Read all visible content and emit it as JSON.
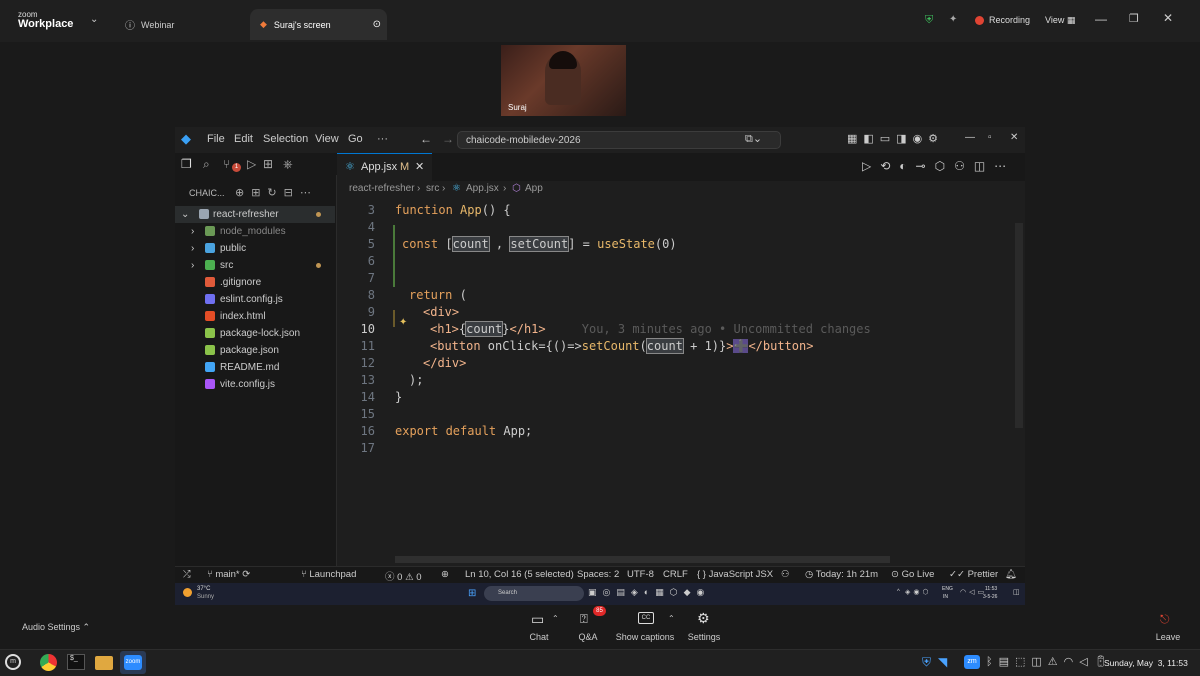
{
  "zoom": {
    "logo_small": "zoom",
    "logo_big": "Workplace",
    "tabs": [
      {
        "label": "Webinar"
      },
      {
        "label": "Suraj's screen"
      }
    ],
    "recording_label": "Recording",
    "view_label": "View",
    "participant_name": "Suraj",
    "audio_settings": "Audio Settings",
    "bottom": {
      "chat": "Chat",
      "qa": "Q&A",
      "qa_badge": "85",
      "captions": "Show captions",
      "settings": "Settings",
      "leave": "Leave"
    }
  },
  "vscode": {
    "menu": [
      "File",
      "Edit",
      "Selection",
      "View",
      "Go",
      "···"
    ],
    "command_center": "chaicode-mobiledev-2026",
    "explorer_title": "CHAIC...",
    "root_folder": "react-refresher",
    "files": [
      {
        "name": "node_modules",
        "kind": "folder",
        "color": "#6a9955"
      },
      {
        "name": "public",
        "kind": "folder",
        "color": "#4aa3df"
      },
      {
        "name": "src",
        "kind": "folder",
        "color": "#4caf50"
      },
      {
        "name": ".gitignore",
        "kind": "file",
        "color": "#e05a3a"
      },
      {
        "name": "eslint.config.js",
        "kind": "file",
        "color": "#6f6ff0"
      },
      {
        "name": "index.html",
        "kind": "file",
        "color": "#e44d26"
      },
      {
        "name": "package-lock.json",
        "kind": "file",
        "color": "#8bc34a"
      },
      {
        "name": "package.json",
        "kind": "file",
        "color": "#8bc34a"
      },
      {
        "name": "README.md",
        "kind": "file",
        "color": "#42a5f5"
      },
      {
        "name": "vite.config.js",
        "kind": "file",
        "color": "#a855f7"
      }
    ],
    "tab_label": "App.jsx",
    "tab_modified": "M",
    "breadcrumb": [
      "react-refresher",
      "src",
      "App.jsx",
      "App"
    ],
    "line_numbers": [
      "3",
      "4",
      "5",
      "6",
      "7",
      "8",
      "9",
      "10",
      "11",
      "12",
      "13",
      "14",
      "15",
      "16",
      "17"
    ],
    "blame": "You, 3 minutes ago • Uncommitted changes",
    "status": {
      "branch": "main*",
      "launchpad": "Launchpad",
      "errors": "0",
      "warnings": "0",
      "cursor": "Ln 10, Col 16 (5 selected)",
      "spaces": "Spaces: 2",
      "encoding": "UTF-8",
      "eol": "CRLF",
      "language": "JavaScript JSX",
      "today": "Today: 1h 21m",
      "golive": "Go Live",
      "prettier": "Prettier"
    }
  },
  "win_taskbar": {
    "weather_temp": "37°C",
    "weather_desc": "Sunny",
    "search": "Search",
    "lang1": "ENG",
    "lang2": "IN",
    "time": "11:53",
    "date": "3-5-26"
  },
  "os_taskbar": {
    "clock": "Sunday, May  3, 11:53"
  },
  "colors": {
    "accent": "#0078d4",
    "recording": "#e04433"
  }
}
